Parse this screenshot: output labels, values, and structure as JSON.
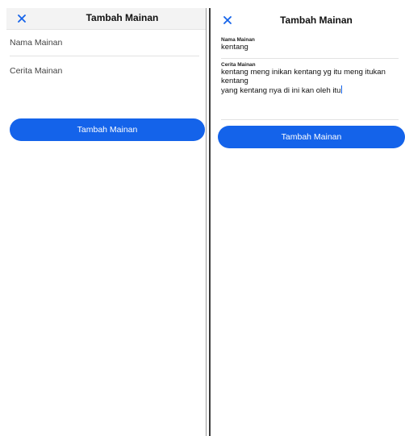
{
  "left_screen": {
    "header": {
      "title": "Tambah Mainan",
      "close_icon": "close-icon",
      "accent": "#1463ea"
    },
    "form": {
      "name_placeholder": "Nama Mainan",
      "story_placeholder": "Cerita Mainan"
    },
    "submit_label": "Tambah Mainan"
  },
  "right_screen": {
    "header": {
      "title": "Tambah Mainan",
      "close_icon": "close-icon"
    },
    "form": {
      "name_label": "Nama Mainan",
      "name_value": "kentang",
      "story_label": "Cerita Mainan",
      "story_lines": [
        "kentang meng inikan kentang yg itu meng itukan",
        "kentang",
        "yang kentang nya di ini kan oleh itu"
      ]
    },
    "submit_label": "Tambah Mainan"
  },
  "colors": {
    "primary": "#1463ea",
    "text": "#111111",
    "divider": "#e2e2e2"
  }
}
